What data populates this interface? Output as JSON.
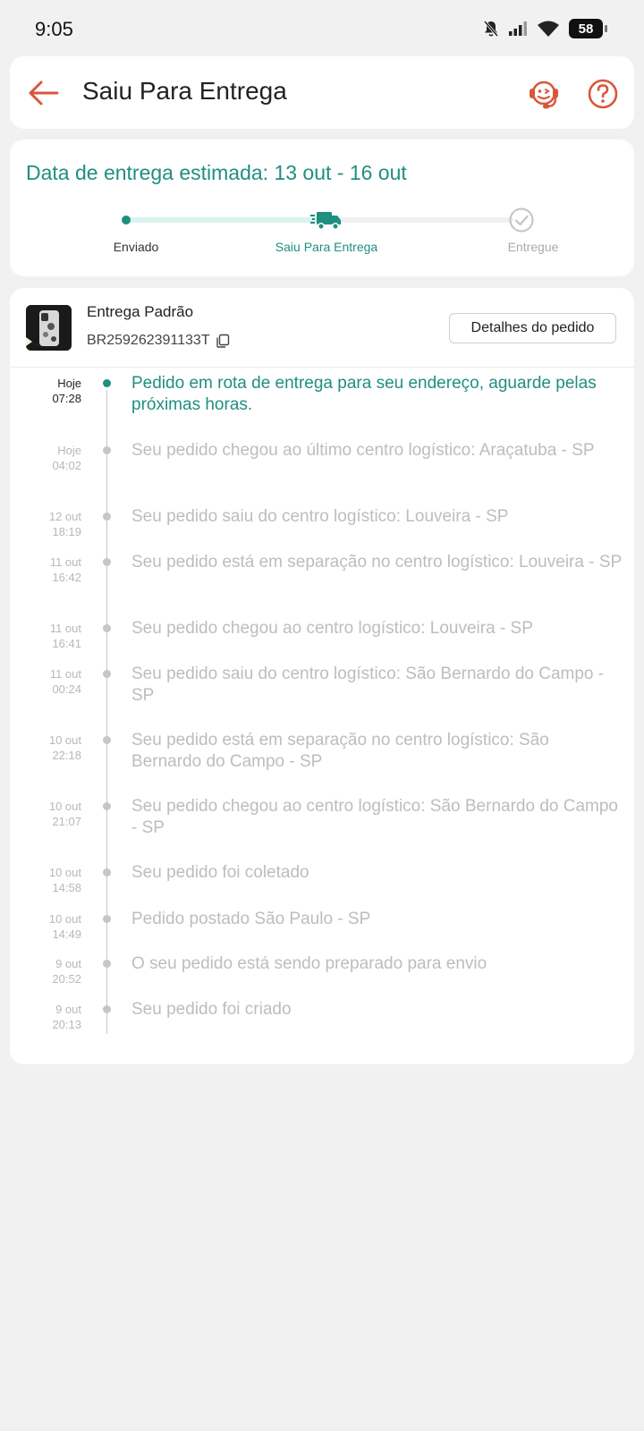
{
  "status_bar": {
    "time": "9:05",
    "battery": "58",
    "icons": [
      "mute-icon",
      "signal-icon",
      "wifi-icon",
      "battery-icon"
    ]
  },
  "header": {
    "title": "Saiu Para Entrega",
    "icons": [
      "back-arrow-icon",
      "support-agent-icon",
      "help-icon"
    ]
  },
  "delivery": {
    "estimate": "Data de entrega estimada: 13 out - 16 out",
    "steps": [
      {
        "label": "Enviado",
        "state": "done"
      },
      {
        "label": "Saiu Para Entrega",
        "state": "current"
      },
      {
        "label": "Entregue",
        "state": "pending"
      }
    ]
  },
  "shipment": {
    "method": "Entrega Padrão",
    "tracking_code": "BR259262391133T",
    "details_button": "Detalhes do pedido"
  },
  "events": [
    {
      "date": "Hoje",
      "time": "07:28",
      "text": "Pedido em rota de entrega para seu endereço, aguarde pelas próximas horas.",
      "current": true
    },
    {
      "date": "Hoje",
      "time": "04:02",
      "text": "Seu pedido chegou ao último centro logístico: Araçatuba - SP"
    },
    {
      "date": "12 out",
      "time": "18:19",
      "text": "Seu pedido saiu do centro logístico: Louveira - SP"
    },
    {
      "date": "11 out",
      "time": "16:42",
      "text": "Seu pedido está em separação no centro logístico: Louveira - SP"
    },
    {
      "date": "11 out",
      "time": "16:41",
      "text": "Seu pedido chegou ao centro logístico: Louveira - SP"
    },
    {
      "date": "11 out",
      "time": "00:24",
      "text": "Seu pedido saiu do centro logístico: São Bernardo do Campo - SP"
    },
    {
      "date": "10 out",
      "time": "22:18",
      "text": "Seu pedido está em separação no centro logístico: São Bernardo do Campo - SP"
    },
    {
      "date": "10 out",
      "time": "21:07",
      "text": "Seu pedido chegou ao centro logístico: São Bernardo do Campo - SP"
    },
    {
      "date": "10 out",
      "time": "14:58",
      "text": "Seu pedido foi coletado"
    },
    {
      "date": "10 out",
      "time": "14:49",
      "text": "Pedido postado São Paulo - SP"
    },
    {
      "date": "9 out",
      "time": "20:52",
      "text": "O seu pedido está sendo preparado para envio"
    },
    {
      "date": "9 out",
      "time": "20:13",
      "text": "Seu pedido foi criado"
    }
  ],
  "colors": {
    "accent": "#1f8f80",
    "header_icons": "#d9573a",
    "muted_text": "#bdbdbd",
    "background": "#f1f1f1"
  }
}
